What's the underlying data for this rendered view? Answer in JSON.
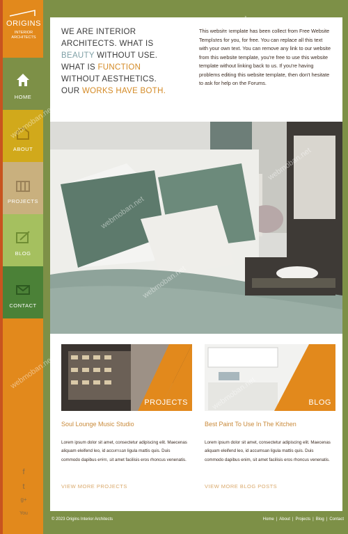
{
  "logo": {
    "name": "ORIGINS",
    "sub": "INTERIOR ARCHITECTS"
  },
  "nav": [
    {
      "label": "HOME",
      "icon": "house-icon"
    },
    {
      "label": "ABOUT",
      "icon": "about-icon"
    },
    {
      "label": "PROJECTS",
      "icon": "projects-icon"
    },
    {
      "label": "BLOG",
      "icon": "blog-icon"
    },
    {
      "label": "CONTACT",
      "icon": "contact-icon"
    }
  ],
  "social": [
    "f",
    "t",
    "g+",
    "You"
  ],
  "headline": {
    "l1": "WE ARE INTERIOR",
    "l2": "ARCHITECTS. WHAT IS",
    "l3a": "BEAUTY",
    "l3b": " WITHOUT USE.",
    "l4a": "WHAT IS ",
    "l4b": "FUNCTION",
    "l5": "WITHOUT AESTHETICS.",
    "l6a": "OUR ",
    "l6b": "WORKS HAVE BOTH."
  },
  "intro": "This website template has been collect from Free Website Templates for you, for free. You can replace all this text with your own text. You can remove any link to our website from this website template, you're free to use this website template without linking back to us. If you're having problems editing this website template, then don't hesitate to ask for help on the Forums.",
  "cards": [
    {
      "label": "PROJECTS",
      "title": "Soul Lounge Music Studio",
      "text": "Lorem ipsum dolor sit amet, consectetur adipiscing elit. Maecenas aliquam eleifend leo, id accumsan ligula mattis quis. Duis commodo dapibus enim, sit amet facilisis eros rhoncus venenatis.",
      "more": "VIEW MORE PROJECTS"
    },
    {
      "label": "BLOG",
      "title": "Best Paint To Use In The Kitchen",
      "text": "Lorem ipsum dolor sit amet, consectetur adipiscing elit. Maecenas aliquam eleifend leo, id accumsan ligula mattis quis. Duis commodo dapibus enim, sit amet facilisis eros rhoncus venenatis.",
      "more": "VIEW MORE BLOG POSTS"
    }
  ],
  "footer": {
    "copy": "© 2023 Origins Interior Architects",
    "links": [
      "Home",
      "About",
      "Projects",
      "Blog",
      "Contact"
    ]
  },
  "watermark": "webmoban.net",
  "colors": {
    "orange": "#e2891c",
    "olive": "#7d9047",
    "mustard": "#d1a91b",
    "tan": "#c9b07e",
    "lime": "#a5c05f",
    "green": "#4b8137"
  }
}
